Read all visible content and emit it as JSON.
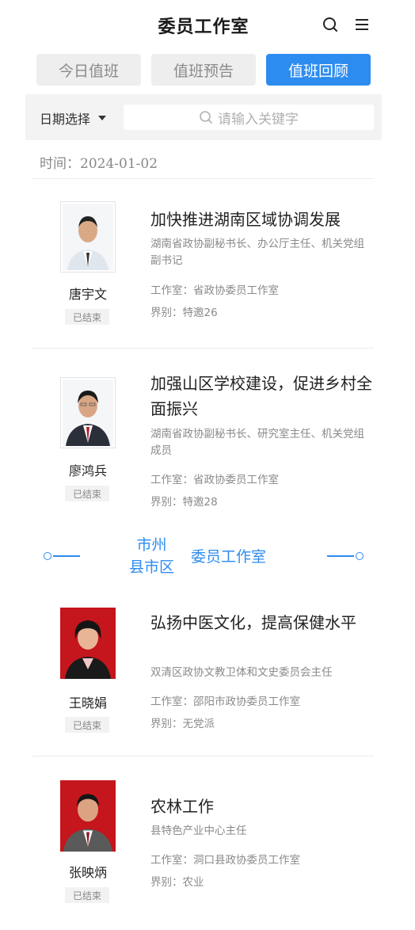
{
  "header": {
    "title": "委员工作室",
    "search_icon": "search-icon",
    "menu_icon": "menu-icon"
  },
  "tabs": [
    {
      "label": "今日值班",
      "active": false
    },
    {
      "label": "值班预告",
      "active": false
    },
    {
      "label": "值班回顾",
      "active": true
    }
  ],
  "filter": {
    "date_label": "日期选择",
    "search_placeholder": "请输入关键字"
  },
  "date_line": "时间：2024-01-02",
  "section_separator": {
    "line1": "市州",
    "line2": "县市区",
    "main": "委员工作室"
  },
  "provincial_members": [
    {
      "name": "唐宇文",
      "status": "已结束",
      "topic": "加快推进湖南区域协调发展",
      "position": "湖南省政协副秘书长、办公厅主任、机关党组副书记",
      "studio": "工作室：省政协委员工作室",
      "sector": "界别：特邀26"
    },
    {
      "name": "廖鸿兵",
      "status": "已结束",
      "topic": "加强山区学校建设，促进乡村全面振兴",
      "position": "湖南省政协副秘书长、研究室主任、机关党组成员",
      "studio": "工作室：省政协委员工作室",
      "sector": "界别：特邀28"
    }
  ],
  "local_members": [
    {
      "name": "王晓娟",
      "status": "已结束",
      "topic": "弘扬中医文化，提高保健水平",
      "position": "双清区政协文教卫体和文史委员会主任",
      "studio": "工作室：邵阳市政协委员工作室",
      "sector": "界别：无党派"
    },
    {
      "name": "张映炳",
      "status": "已结束",
      "topic": "农林工作",
      "position": "县特色产业中心主任",
      "studio": "工作室：洞口县政协委员工作室",
      "sector": "界别：农业"
    }
  ],
  "colors": {
    "accent": "#2d8cf0",
    "tab_inactive_bg": "#eeeeee",
    "muted_text": "#8a8a8a"
  }
}
